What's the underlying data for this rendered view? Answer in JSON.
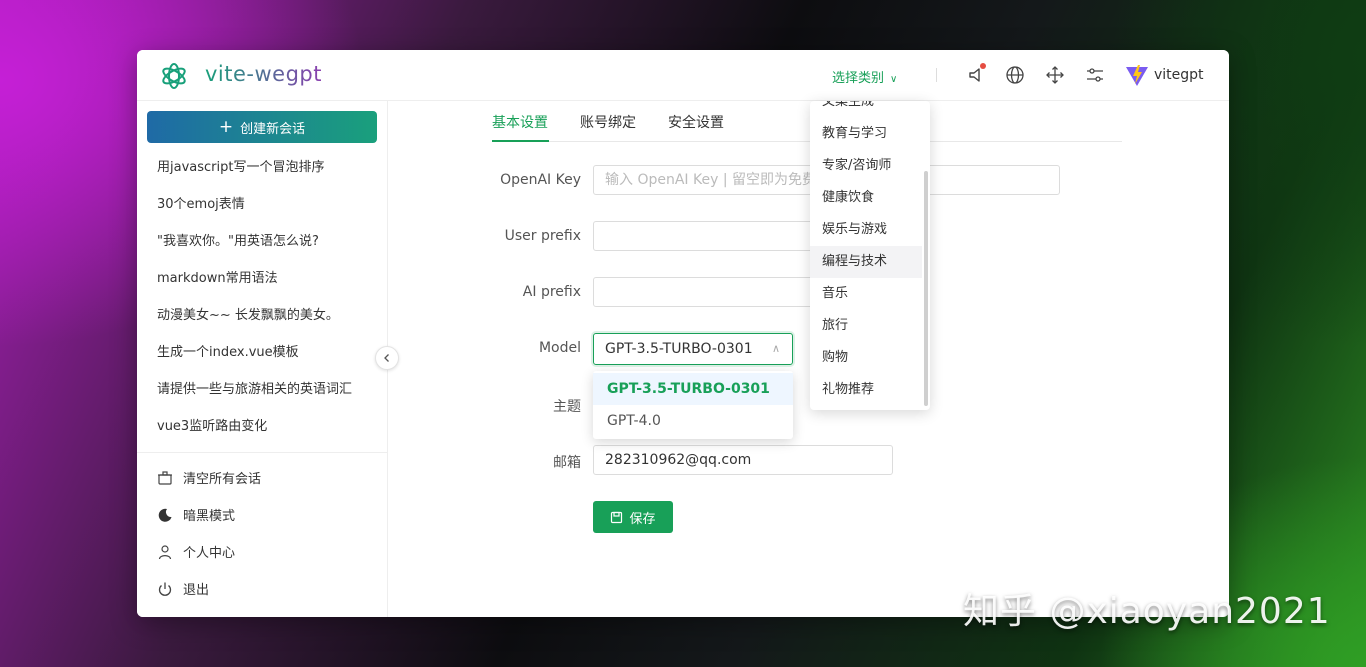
{
  "header": {
    "app_title": "vite-wegpt",
    "category_select": "选择类别",
    "user_name": "vitegpt",
    "icons": [
      "openai-logo-icon",
      "chevron-down-icon",
      "notification-icon",
      "language-icon",
      "fullscreen-icon",
      "settings-icon",
      "vite-logo-icon"
    ],
    "notification_dot_color": "#e54d42"
  },
  "sidebar": {
    "new_chat_label": "创建新会话",
    "history": [
      "用javascript写一个冒泡排序",
      "30个emoj表情",
      "\"我喜欢你。\"用英语怎么说?",
      "markdown常用语法",
      "动漫美女~~ 长发飘飘的美女。",
      "生成一个index.vue模板",
      "请提供一些与旅游相关的英语词汇",
      "vue3监听路由变化"
    ],
    "footer": {
      "clear_all": "清空所有会话",
      "dark_mode": "暗黑模式",
      "profile": "个人中心",
      "logout": "退出"
    }
  },
  "settings": {
    "tabs": [
      "基本设置",
      "账号绑定",
      "安全设置"
    ],
    "active_tab": "基本设置",
    "labels": {
      "openai_key": "OpenAI Key",
      "user_prefix": "User prefix",
      "ai_prefix": "AI prefix",
      "model": "Model",
      "theme": "主题",
      "email": "邮箱"
    },
    "openai_key_placeholder": "输入 OpenAI Key | 留空即为免费",
    "user_prefix_value": "",
    "ai_prefix_value": "",
    "model_value": "GPT-3.5-TURBO-0301",
    "model_options": [
      "GPT-3.5-TURBO-0301",
      "GPT-4.0"
    ],
    "email_value": "282310962@qq.com",
    "save_label": "保存"
  },
  "category_dropdown": {
    "items": [
      "文案生成",
      "教育与学习",
      "专家/咨询师",
      "健康饮食",
      "娱乐与游戏",
      "编程与技术",
      "音乐",
      "旅行",
      "购物",
      "礼物推荐"
    ],
    "hovered": "编程与技术"
  },
  "watermark": "知乎 @xiaoyan2021",
  "colors": {
    "accent": "#18a058",
    "button_gradient_start": "#1f6aa6",
    "button_gradient_end": "#1aa07c"
  }
}
